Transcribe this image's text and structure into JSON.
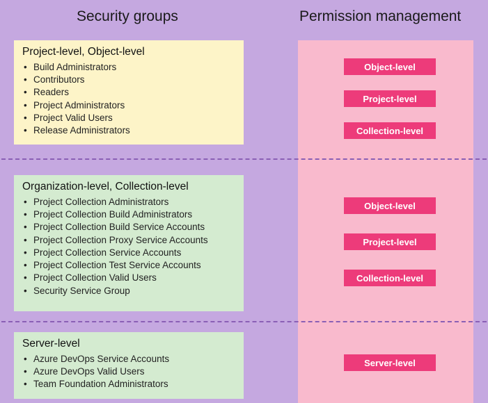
{
  "headers": {
    "left": "Security groups",
    "right": "Permission management"
  },
  "sections": [
    {
      "key": "project",
      "title": "Project-level, Object-level",
      "items": [
        "Build Administrators",
        "Contributors",
        "Readers",
        "Project Administrators",
        "Project Valid Users",
        "Release Administrators"
      ],
      "chips": [
        "Object-level",
        "Project-level",
        "Collection-level"
      ]
    },
    {
      "key": "org",
      "title": "Organization-level, Collection-level",
      "items": [
        "Project Collection Administrators",
        "Project Collection Build Administrators",
        "Project Collection Build Service Accounts",
        "Project Collection Proxy Service Accounts",
        "Project Collection Service Accounts",
        "Project Collection Test Service Accounts",
        "Project Collection Valid Users",
        "Security Service Group"
      ],
      "chips": [
        "Object-level",
        "Project-level",
        "Collection-level"
      ]
    },
    {
      "key": "server",
      "title": "Server-level",
      "items": [
        "Azure DevOps Service Accounts",
        "Azure DevOps Valid Users",
        "Team Foundation Administrators"
      ],
      "chips": [
        "Server-level"
      ]
    }
  ],
  "chipPositions": {
    "project": [
      84,
      130,
      176
    ],
    "org": [
      284,
      336,
      388
    ],
    "server": [
      510
    ]
  }
}
